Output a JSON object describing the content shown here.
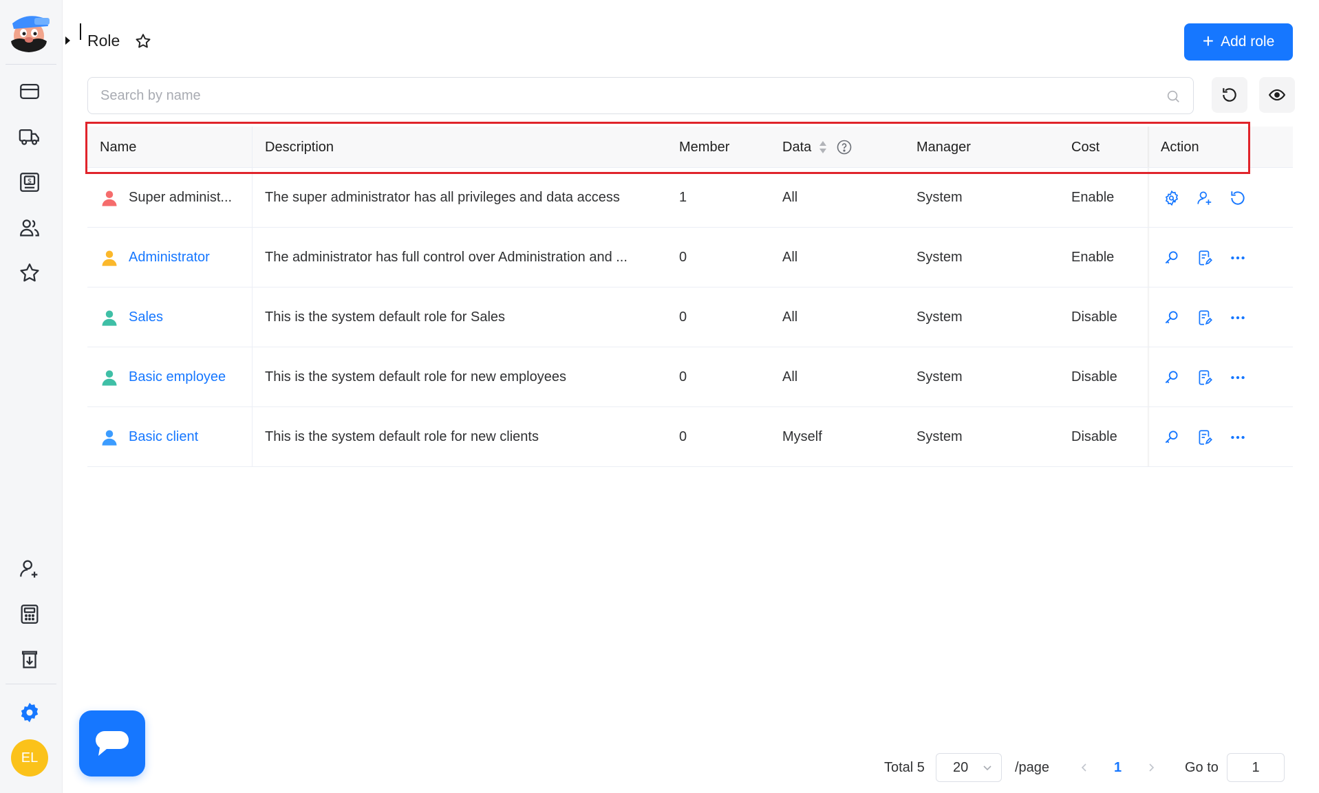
{
  "header": {
    "title": "Role",
    "add_button": "Add role"
  },
  "search": {
    "placeholder": "Search by name",
    "value": ""
  },
  "user": {
    "initials": "EL"
  },
  "sidebar": {
    "top_items": [
      "wallet-icon",
      "truck-icon",
      "invoice-icon",
      "contacts-icon",
      "star-icon"
    ],
    "bottom_items": [
      "add-user-icon",
      "calculator-icon",
      "download-icon",
      "settings-icon"
    ]
  },
  "table": {
    "columns": [
      "Name",
      "Description",
      "Member",
      "Data",
      "Manager",
      "Cost",
      "Action"
    ],
    "rows": [
      {
        "name": "Super administ...",
        "description": "The super administrator has all privileges and data access",
        "member": "1",
        "data": "All",
        "manager": "System",
        "cost": "Enable",
        "icon_color": "#f56c6c",
        "is_link": false
      },
      {
        "name": "Administrator",
        "description": "The administrator has full control over Administration and ...",
        "member": "0",
        "data": "All",
        "manager": "System",
        "cost": "Enable",
        "icon_color": "#fbb82b",
        "is_link": true
      },
      {
        "name": "Sales",
        "description": "This is the system default role for Sales",
        "member": "0",
        "data": "All",
        "manager": "System",
        "cost": "Disable",
        "icon_color": "#3fbfa6",
        "is_link": true
      },
      {
        "name": "Basic employee",
        "description": "This is the system default role for new employees",
        "member": "0",
        "data": "All",
        "manager": "System",
        "cost": "Disable",
        "icon_color": "#3fbfa6",
        "is_link": true
      },
      {
        "name": "Basic client",
        "description": "This is the system default role for new clients",
        "member": "0",
        "data": "Myself",
        "manager": "System",
        "cost": "Disable",
        "icon_color": "#3c9cff",
        "is_link": true
      }
    ]
  },
  "pagination": {
    "total": "Total 5",
    "page_size": "20",
    "per_page": "/page",
    "current_page": "1",
    "goto_label": "Go to",
    "goto_value": "1"
  },
  "colors": {
    "primary": "#1677ff",
    "highlight": "#e0242b"
  }
}
